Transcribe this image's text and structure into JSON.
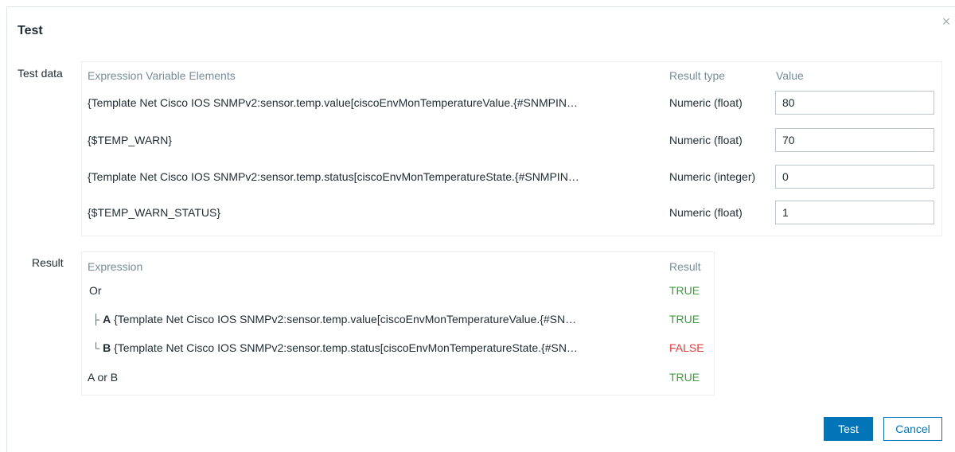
{
  "dialog": {
    "title": "Test",
    "close_glyph": "×"
  },
  "test_data": {
    "label": "Test data",
    "headers": {
      "expression": "Expression Variable Elements",
      "result_type": "Result type",
      "value": "Value"
    },
    "rows": [
      {
        "expression": "{Template Net Cisco IOS SNMPv2:sensor.temp.value[ciscoEnvMonTemperatureValue.{#SNMPIN…",
        "result_type": "Numeric (float)",
        "value": "80"
      },
      {
        "expression": "{$TEMP_WARN}",
        "result_type": "Numeric (float)",
        "value": "70"
      },
      {
        "expression": "{Template Net Cisco IOS SNMPv2:sensor.temp.status[ciscoEnvMonTemperatureState.{#SNMPIN…",
        "result_type": "Numeric (integer)",
        "value": "0"
      },
      {
        "expression": "{$TEMP_WARN_STATUS}",
        "result_type": "Numeric (float)",
        "value": "1"
      }
    ]
  },
  "result": {
    "label": "Result",
    "headers": {
      "expression": "Expression",
      "result": "Result"
    },
    "rows": [
      {
        "prefix": "",
        "bold": "",
        "text": "Or",
        "result": "TRUE",
        "status": "true"
      },
      {
        "prefix": "├",
        "bold": "A",
        "text": "{Template Net Cisco IOS SNMPv2:sensor.temp.value[ciscoEnvMonTemperatureValue.{#SN…",
        "result": "TRUE",
        "status": "true"
      },
      {
        "prefix": "└",
        "bold": "B",
        "text": "{Template Net Cisco IOS SNMPv2:sensor.temp.status[ciscoEnvMonTemperatureState.{#SN…",
        "result": "FALSE",
        "status": "false"
      },
      {
        "prefix": "",
        "bold": "",
        "text": "A or B",
        "result": "TRUE",
        "status": "true"
      }
    ]
  },
  "buttons": {
    "test": "Test",
    "cancel": "Cancel"
  },
  "colors": {
    "true": "#3a9e3a",
    "false": "#e43c3c",
    "primary": "#0275b8"
  }
}
